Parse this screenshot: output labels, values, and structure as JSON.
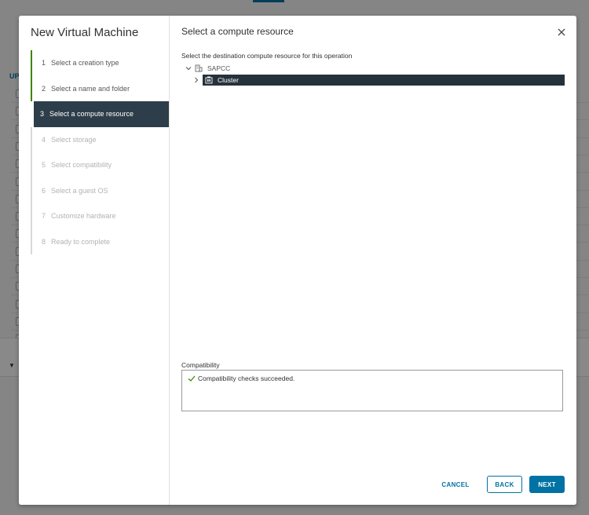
{
  "background": {
    "column_label": "UP",
    "filter_icon": "filter-icon"
  },
  "wizard": {
    "title": "New Virtual Machine",
    "steps": [
      {
        "num": "1",
        "label": "Select a creation type",
        "state": "done"
      },
      {
        "num": "2",
        "label": "Select a name and folder",
        "state": "done"
      },
      {
        "num": "3",
        "label": "Select a compute resource",
        "state": "active"
      },
      {
        "num": "4",
        "label": "Select storage",
        "state": "disabled"
      },
      {
        "num": "5",
        "label": "Select compatibility",
        "state": "disabled"
      },
      {
        "num": "6",
        "label": "Select a guest OS",
        "state": "disabled"
      },
      {
        "num": "7",
        "label": "Customize hardware",
        "state": "disabled"
      },
      {
        "num": "8",
        "label": "Ready to complete",
        "state": "disabled"
      }
    ]
  },
  "content": {
    "title": "Select a compute resource",
    "instruction": "Select the destination compute resource for this operation",
    "tree": {
      "root": {
        "label": "SAPCC",
        "icon": "datacenter-icon",
        "expanded": true
      },
      "child": {
        "label": "Cluster",
        "icon": "cluster-icon",
        "expanded": false,
        "selected": true
      }
    },
    "compatibility": {
      "label": "Compatibility",
      "message": "Compatibility checks succeeded.",
      "status_icon": "check-icon"
    }
  },
  "footer": {
    "cancel": "CANCEL",
    "back": "BACK",
    "next": "NEXT"
  },
  "colors": {
    "accent": "#0072a3",
    "active_step_bg": "#2d3d49",
    "done_step_bar": "#3c8500",
    "success": "#3c8500"
  }
}
